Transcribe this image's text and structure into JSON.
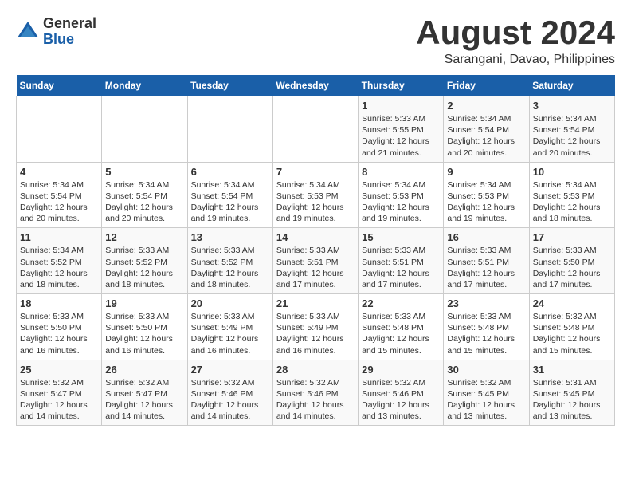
{
  "logo": {
    "general": "General",
    "blue": "Blue"
  },
  "title": {
    "month_year": "August 2024",
    "location": "Sarangani, Davao, Philippines"
  },
  "days_of_week": [
    "Sunday",
    "Monday",
    "Tuesday",
    "Wednesday",
    "Thursday",
    "Friday",
    "Saturday"
  ],
  "weeks": [
    [
      {
        "day": "",
        "info": ""
      },
      {
        "day": "",
        "info": ""
      },
      {
        "day": "",
        "info": ""
      },
      {
        "day": "",
        "info": ""
      },
      {
        "day": "1",
        "info": "Sunrise: 5:33 AM\nSunset: 5:55 PM\nDaylight: 12 hours\nand 21 minutes."
      },
      {
        "day": "2",
        "info": "Sunrise: 5:34 AM\nSunset: 5:54 PM\nDaylight: 12 hours\nand 20 minutes."
      },
      {
        "day": "3",
        "info": "Sunrise: 5:34 AM\nSunset: 5:54 PM\nDaylight: 12 hours\nand 20 minutes."
      }
    ],
    [
      {
        "day": "4",
        "info": "Sunrise: 5:34 AM\nSunset: 5:54 PM\nDaylight: 12 hours\nand 20 minutes."
      },
      {
        "day": "5",
        "info": "Sunrise: 5:34 AM\nSunset: 5:54 PM\nDaylight: 12 hours\nand 20 minutes."
      },
      {
        "day": "6",
        "info": "Sunrise: 5:34 AM\nSunset: 5:54 PM\nDaylight: 12 hours\nand 19 minutes."
      },
      {
        "day": "7",
        "info": "Sunrise: 5:34 AM\nSunset: 5:53 PM\nDaylight: 12 hours\nand 19 minutes."
      },
      {
        "day": "8",
        "info": "Sunrise: 5:34 AM\nSunset: 5:53 PM\nDaylight: 12 hours\nand 19 minutes."
      },
      {
        "day": "9",
        "info": "Sunrise: 5:34 AM\nSunset: 5:53 PM\nDaylight: 12 hours\nand 19 minutes."
      },
      {
        "day": "10",
        "info": "Sunrise: 5:34 AM\nSunset: 5:53 PM\nDaylight: 12 hours\nand 18 minutes."
      }
    ],
    [
      {
        "day": "11",
        "info": "Sunrise: 5:34 AM\nSunset: 5:52 PM\nDaylight: 12 hours\nand 18 minutes."
      },
      {
        "day": "12",
        "info": "Sunrise: 5:33 AM\nSunset: 5:52 PM\nDaylight: 12 hours\nand 18 minutes."
      },
      {
        "day": "13",
        "info": "Sunrise: 5:33 AM\nSunset: 5:52 PM\nDaylight: 12 hours\nand 18 minutes."
      },
      {
        "day": "14",
        "info": "Sunrise: 5:33 AM\nSunset: 5:51 PM\nDaylight: 12 hours\nand 17 minutes."
      },
      {
        "day": "15",
        "info": "Sunrise: 5:33 AM\nSunset: 5:51 PM\nDaylight: 12 hours\nand 17 minutes."
      },
      {
        "day": "16",
        "info": "Sunrise: 5:33 AM\nSunset: 5:51 PM\nDaylight: 12 hours\nand 17 minutes."
      },
      {
        "day": "17",
        "info": "Sunrise: 5:33 AM\nSunset: 5:50 PM\nDaylight: 12 hours\nand 17 minutes."
      }
    ],
    [
      {
        "day": "18",
        "info": "Sunrise: 5:33 AM\nSunset: 5:50 PM\nDaylight: 12 hours\nand 16 minutes."
      },
      {
        "day": "19",
        "info": "Sunrise: 5:33 AM\nSunset: 5:50 PM\nDaylight: 12 hours\nand 16 minutes."
      },
      {
        "day": "20",
        "info": "Sunrise: 5:33 AM\nSunset: 5:49 PM\nDaylight: 12 hours\nand 16 minutes."
      },
      {
        "day": "21",
        "info": "Sunrise: 5:33 AM\nSunset: 5:49 PM\nDaylight: 12 hours\nand 16 minutes."
      },
      {
        "day": "22",
        "info": "Sunrise: 5:33 AM\nSunset: 5:48 PM\nDaylight: 12 hours\nand 15 minutes."
      },
      {
        "day": "23",
        "info": "Sunrise: 5:33 AM\nSunset: 5:48 PM\nDaylight: 12 hours\nand 15 minutes."
      },
      {
        "day": "24",
        "info": "Sunrise: 5:32 AM\nSunset: 5:48 PM\nDaylight: 12 hours\nand 15 minutes."
      }
    ],
    [
      {
        "day": "25",
        "info": "Sunrise: 5:32 AM\nSunset: 5:47 PM\nDaylight: 12 hours\nand 14 minutes."
      },
      {
        "day": "26",
        "info": "Sunrise: 5:32 AM\nSunset: 5:47 PM\nDaylight: 12 hours\nand 14 minutes."
      },
      {
        "day": "27",
        "info": "Sunrise: 5:32 AM\nSunset: 5:46 PM\nDaylight: 12 hours\nand 14 minutes."
      },
      {
        "day": "28",
        "info": "Sunrise: 5:32 AM\nSunset: 5:46 PM\nDaylight: 12 hours\nand 14 minutes."
      },
      {
        "day": "29",
        "info": "Sunrise: 5:32 AM\nSunset: 5:46 PM\nDaylight: 12 hours\nand 13 minutes."
      },
      {
        "day": "30",
        "info": "Sunrise: 5:32 AM\nSunset: 5:45 PM\nDaylight: 12 hours\nand 13 minutes."
      },
      {
        "day": "31",
        "info": "Sunrise: 5:31 AM\nSunset: 5:45 PM\nDaylight: 12 hours\nand 13 minutes."
      }
    ]
  ]
}
